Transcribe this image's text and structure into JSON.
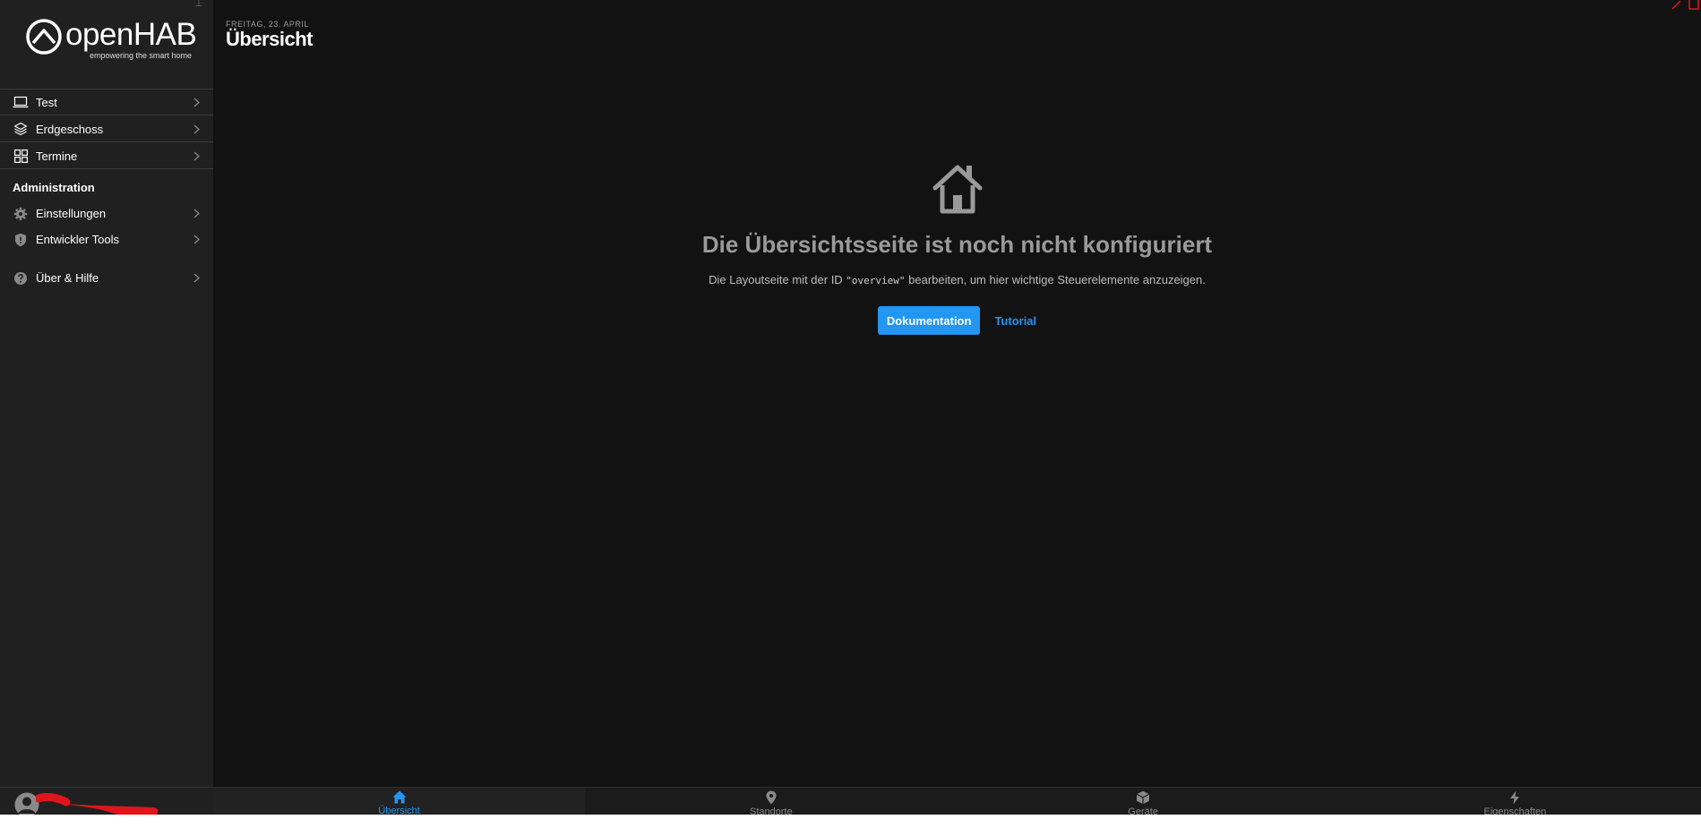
{
  "app": {
    "brand": "openHAB",
    "tagline": "empowering the smart home"
  },
  "sidebar": {
    "items": [
      {
        "label": "Test",
        "icon": "laptop-icon"
      },
      {
        "label": "Erdgeschoss",
        "icon": "layers-icon"
      },
      {
        "label": "Termine",
        "icon": "grid-icon"
      }
    ],
    "admin_title": "Administration",
    "admin_items": [
      {
        "label": "Einstellungen",
        "icon": "gear-icon"
      },
      {
        "label": "Entwickler Tools",
        "icon": "shield-icon"
      }
    ],
    "help_item": {
      "label": "Über & Hilfe",
      "icon": "question-icon"
    }
  },
  "header": {
    "date": "FREITAG, 23. APRIL",
    "title": "Übersicht"
  },
  "empty_state": {
    "title": "Die Übersichtsseite ist noch nicht konfiguriert",
    "desc_before": "Die Layoutseite mit der ID ",
    "desc_code": "\"overview\"",
    "desc_after": " bearbeiten, um hier wichtige Steuerelemente anzuzeigen.",
    "primary_button": "Dokumentation",
    "link_button": "Tutorial"
  },
  "tabbar": {
    "tabs": [
      {
        "label": "Übersicht",
        "icon": "home-icon",
        "active": true
      },
      {
        "label": "Standorte",
        "icon": "location-pin-icon",
        "active": false
      },
      {
        "label": "Geräte",
        "icon": "cube-icon",
        "active": false
      },
      {
        "label": "Eigenschaften",
        "icon": "bolt-icon",
        "active": false
      }
    ]
  },
  "colors": {
    "accent": "#2196f3",
    "background": "#121212",
    "sidebar": "#202020",
    "redaction": "#e0151b"
  }
}
